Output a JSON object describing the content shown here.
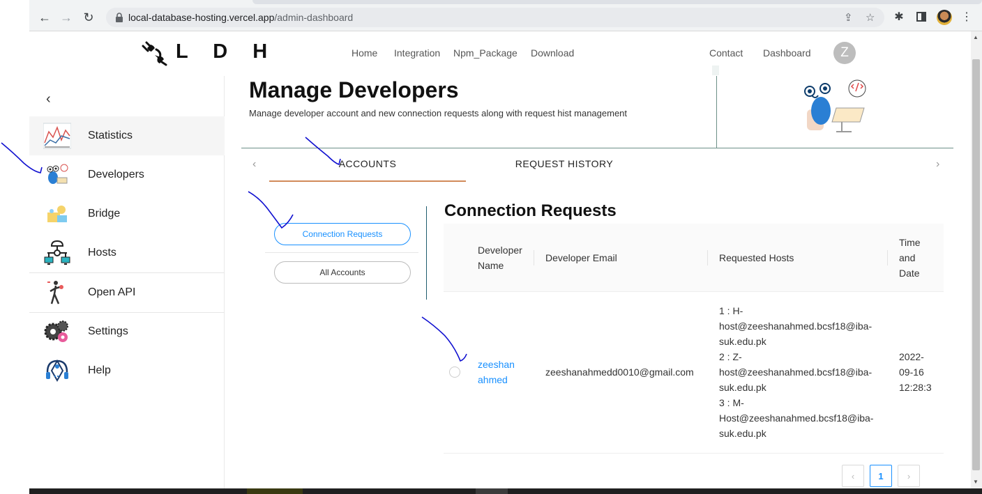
{
  "browser": {
    "url_host": "local-database-hosting.vercel.app",
    "url_path": "/admin-dashboard"
  },
  "header": {
    "logo_text": "L D H",
    "nav": [
      "Home",
      "Integration",
      "Npm_Package",
      "Download"
    ],
    "right_nav": [
      "Contact",
      "Dashboard"
    ],
    "avatar_initial": "Z"
  },
  "sidebar": {
    "items": [
      {
        "label": "Statistics",
        "icon": "statistics-chart-icon"
      },
      {
        "label": "Developers",
        "icon": "developers-robot-icon"
      },
      {
        "label": "Bridge",
        "icon": "bridge-icon"
      },
      {
        "label": "Hosts",
        "icon": "hosts-network-icon"
      },
      {
        "label": "Open API",
        "icon": "open-api-icon"
      },
      {
        "label": "Settings",
        "icon": "settings-gears-icon"
      },
      {
        "label": "Help",
        "icon": "help-headset-icon"
      }
    ]
  },
  "page": {
    "title": "Manage Developers",
    "subtitle": "Manage developer account and new connection requests along with request hist management"
  },
  "tabs": [
    {
      "label": "ACCOUNTS",
      "active": true
    },
    {
      "label": "REQUEST HISTORY",
      "active": false
    }
  ],
  "filters": {
    "connection_requests": "Connection Requests",
    "all_accounts": "All Accounts"
  },
  "section": {
    "title": "Connection Requests"
  },
  "table": {
    "headers": {
      "name_line1": "Developer",
      "name_line2": "Name",
      "email": "Developer Email",
      "hosts": "Requested Hosts",
      "time_line1": "Time",
      "time_line2": "and",
      "time_line3": "Date"
    },
    "rows": [
      {
        "name_line1": "zeeshan",
        "name_line2": "ahmed",
        "email": "zeeshanahmedd0010@gmail.com",
        "hosts": [
          "1 : H-",
          "host@zeeshanahmed.bcsf18@iba-",
          "suk.edu.pk",
          "2 : Z-",
          "host@zeeshanahmed.bcsf18@iba-",
          "suk.edu.pk",
          "3 : M-",
          "Host@zeeshanahmed.bcsf18@iba-",
          "suk.edu.pk"
        ],
        "date_line1": "2022-",
        "date_line2": "09-16",
        "date_line3": "12:28:3"
      }
    ]
  },
  "pagination": {
    "current_page": "1",
    "prev": "‹",
    "next": "›"
  },
  "colors": {
    "accent_blue": "#1890ff",
    "tab_underline": "#d18a5a",
    "divider_teal": "#6b8f87",
    "annotation_ink": "#1010d0"
  }
}
